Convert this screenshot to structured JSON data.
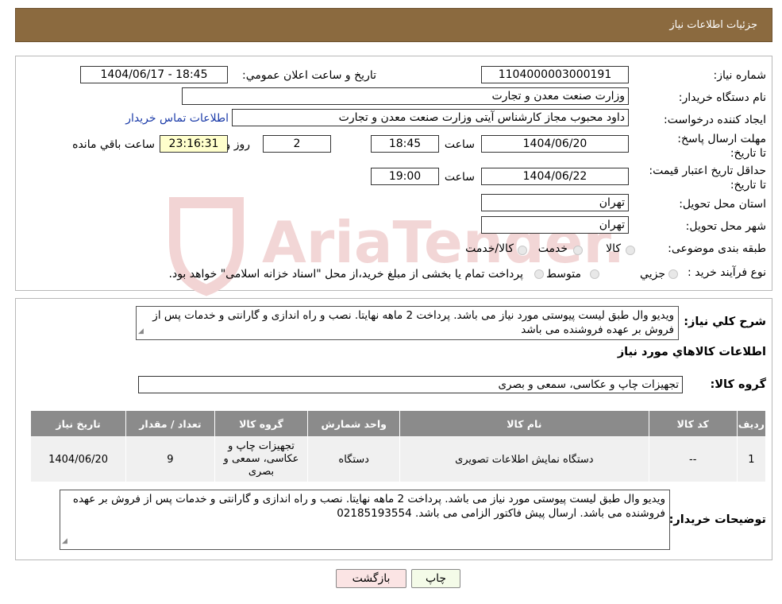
{
  "header": {
    "title": "جزئیات اطلاعات نیاز"
  },
  "watermark": {
    "text": "AriaTender.neT"
  },
  "fields": {
    "need_number_label": "شماره نیاز:",
    "need_number": "1104000003000191",
    "announce_label": "تاریخ و ساعت اعلان عمومي:",
    "announce_value": "1404/06/17 - 18:45",
    "buyer_org_label": "نام دستگاه خريدار:",
    "buyer_org": "وزارت صنعت معدن و تجارت",
    "requester_label": "ايجاد کننده درخواست:",
    "requester": "داود محبوب مجاز کارشناس آیتی وزارت صنعت معدن و تجارت",
    "contact_link": "اطلاعات تماس خريدار",
    "deadline_label": "مهلت ارسال پاسخ: تا تاريخ:",
    "deadline_date": "1404/06/20",
    "time_label": "ساعت",
    "deadline_time": "18:45",
    "days_value": "2",
    "days_label": "روز و",
    "remaining_time": "23:16:31",
    "remaining_label": "ساعت باقي مانده",
    "validity_label": "حداقل تاريخ اعتبار قيمت: تا تاريخ:",
    "validity_date": "1404/06/22",
    "validity_time": "19:00",
    "province_label": "استان محل تحويل:",
    "province": "تهران",
    "city_label": "شهر محل تحويل:",
    "city": "تهران",
    "category_label": "طبقه بندی موضوعی:",
    "category_options": [
      "کالا",
      "خدمت",
      "کالا/خدمت"
    ],
    "purchase_type_label": "نوع فرآيند خريد :",
    "purchase_type_options": [
      "جزيي",
      "متوسط"
    ],
    "purchase_note": "پرداخت تمام يا بخشی از مبلغ خريد،از محل \"اسناد خزانه اسلامی\" خواهد بود."
  },
  "summary": {
    "label": "شرح کلي نياز:",
    "text": "ویدیو وال طبق لیست پیوستی مورد نیاز می باشد. پرداخت 2 ماهه نهایتا. نصب و راه اندازی و گارانتی و خدمات پس از فروش بر عهده فروشنده می باشد"
  },
  "goods_info": {
    "title": "اطلاعات کالاهاي مورد نياز",
    "group_label": "گروه کالا:",
    "group_value": "تجهيزات چاپ و عکاسی، سمعی و بصری"
  },
  "table": {
    "headers": [
      "رديف",
      "کد کالا",
      "نام کالا",
      "واحد شمارش",
      "گروه کالا",
      "تعداد / مقدار",
      "تاريخ نياز"
    ],
    "rows": [
      {
        "row": "1",
        "code": "--",
        "name": "دستگاه نمایش اطلاعات تصویری",
        "unit": "دستگاه",
        "group": "تجهيزات چاپ و عکاسی، سمعی و بصری",
        "qty": "9",
        "date": "1404/06/20"
      }
    ]
  },
  "buyer_notes": {
    "label": "توضيحات خريدار:",
    "text": "ویدیو وال طبق لیست پیوستی مورد نیاز می باشد. پرداخت 2 ماهه نهایتا. نصب و راه اندازی و گارانتی و خدمات پس از فروش بر عهده فروشنده می باشد. ارسال پیش فاکتور الزامی می باشد. 02185193554"
  },
  "buttons": {
    "print": "چاپ",
    "back": "بازگشت"
  }
}
